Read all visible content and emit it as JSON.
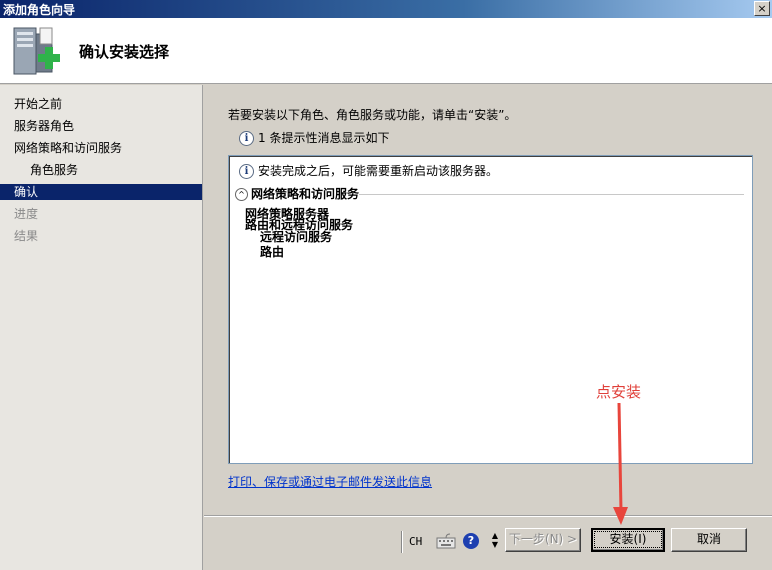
{
  "window": {
    "title": "添加角色向导",
    "close_glyph": "×"
  },
  "header": {
    "heading": "确认安装选择",
    "logo_icon": "server-add-role-icon"
  },
  "sidebar": {
    "items": [
      {
        "label": "开始之前",
        "state": "normal"
      },
      {
        "label": "服务器角色",
        "state": "normal"
      },
      {
        "label": "网络策略和访问服务",
        "state": "normal"
      },
      {
        "label": "角色服务",
        "state": "normal"
      },
      {
        "label": "确认",
        "state": "active"
      },
      {
        "label": "进度",
        "state": "disabled"
      },
      {
        "label": "结果",
        "state": "disabled"
      }
    ]
  },
  "main": {
    "intro": "若要安装以下角色、角色服务或功能，请单击“安装”。",
    "message_count": "1 条提示性消息显示如下",
    "info_glyph": "i",
    "details": {
      "note": "安装完成之后，可能需要重新启动该服务器。",
      "section_title": "网络策略和访问服务",
      "toggle_glyph": "^",
      "lines": [
        "网络策略服务器",
        "路由和远程访问服务",
        "远程访问服务",
        "路由"
      ]
    },
    "print_link": "打印、保存或通过电子邮件发送此信息"
  },
  "annotation": {
    "label": "点安装",
    "color": "#e0403a"
  },
  "footer": {
    "lang": "CH",
    "help_glyph": "?",
    "spin_glyph_up": "▲",
    "spin_glyph_down": "▼",
    "next_label": "下一步(N) >",
    "install_label": "安装(I)",
    "cancel_label": "取消"
  }
}
